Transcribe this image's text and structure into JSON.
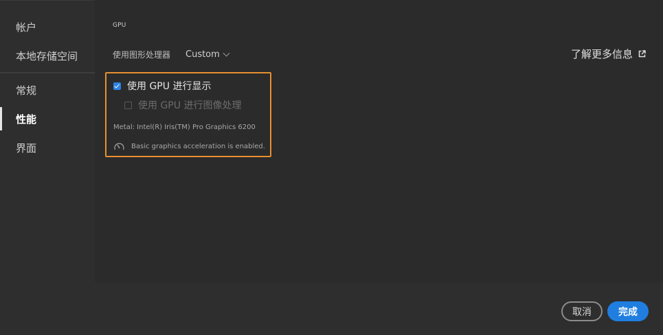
{
  "sidebar": {
    "items": [
      {
        "label": "帐户"
      },
      {
        "label": "本地存储空间"
      },
      {
        "label": "常规"
      },
      {
        "label": "性能",
        "active": true
      },
      {
        "label": "界面"
      }
    ]
  },
  "main": {
    "section_title": "GPU",
    "gpu_processor_label": "使用图形处理器",
    "gpu_processor_value": "Custom",
    "learn_more_label": "了解更多信息",
    "options": {
      "display": {
        "label": "使用 GPU 进行显示",
        "checked": true
      },
      "image_processing": {
        "label": "使用 GPU 进行图像处理",
        "checked": false,
        "disabled": true
      }
    },
    "metal_info": "Metal: Intel(R) Iris(TM) Pro Graphics 6200",
    "acceleration_status": "Basic graphics acceleration is enabled."
  },
  "footer": {
    "cancel_label": "取消",
    "done_label": "完成"
  },
  "colors": {
    "accent": "#1f7ee0",
    "highlight_border": "#e8902f"
  },
  "icons": [
    "chevron-down-icon",
    "external-link-icon",
    "checkbox-checked-icon",
    "checkbox-unchecked-icon",
    "gauge-icon"
  ]
}
